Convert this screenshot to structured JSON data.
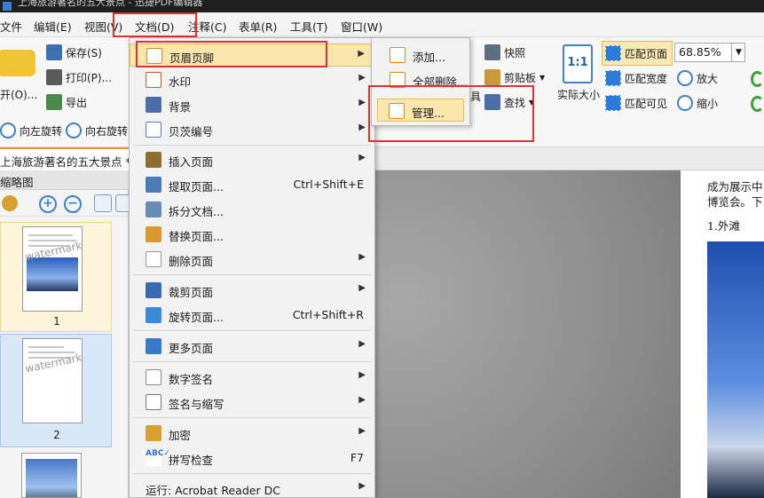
{
  "window": {
    "title": "上海旅游著名的五大景点 - 迅捷PDF编辑器"
  },
  "menubar": {
    "items": [
      {
        "label": "文件"
      },
      {
        "label": "编辑(E)"
      },
      {
        "label": "视图(V)"
      },
      {
        "label": "文档(D)"
      },
      {
        "label": "注释(C)"
      },
      {
        "label": "表单(R)"
      },
      {
        "label": "工具(T)"
      },
      {
        "label": "窗口(W)"
      }
    ]
  },
  "ribbon": {
    "open_label": "开(O)...",
    "save_label": "保存(S)",
    "print_label": "打印(P)...",
    "export_label": "导出",
    "rotate_left_label": "向左旋转",
    "rotate_right_label": "向右旋转",
    "snapshot_label": "快照",
    "clipboard_label": "剪贴板",
    "tools_partial_label": "具",
    "find_label": "查找",
    "actual_size_label": "实际大小",
    "actual_size_icon_text": "1:1",
    "fit_page_label": "匹配页面",
    "fit_width_label": "匹配宽度",
    "fit_visible_label": "匹配可见",
    "zoom_in_label": "放大",
    "zoom_out_label": "缩小",
    "zoom_value": "68.85%"
  },
  "tabs": {
    "document_tab": "上海旅游著名的五大景点 *"
  },
  "sidebar": {
    "title": "缩略图",
    "thumbnails": [
      {
        "page": "1",
        "watermark": "watermark"
      },
      {
        "page": "2",
        "watermark": "watermark"
      }
    ]
  },
  "page_content": {
    "line1": "成为展示中",
    "line2": "博览会。下",
    "heading": "1.外滩"
  },
  "document_menu": {
    "items": [
      {
        "label": "页眉页脚",
        "shortcut": "",
        "submenu": true,
        "icon": "header-footer-icon"
      },
      {
        "label": "水印",
        "shortcut": "",
        "submenu": true,
        "icon": "watermark-icon"
      },
      {
        "label": "背景",
        "shortcut": "",
        "submenu": true,
        "icon": "background-icon"
      },
      {
        "label": "贝茨编号",
        "shortcut": "",
        "submenu": true,
        "icon": "bates-number-icon"
      },
      {
        "label": "插入页面",
        "shortcut": "",
        "submenu": true,
        "icon": "insert-page-icon"
      },
      {
        "label": "提取页面...",
        "shortcut": "Ctrl+Shift+E",
        "submenu": false,
        "icon": "extract-page-icon"
      },
      {
        "label": "拆分文档...",
        "shortcut": "",
        "submenu": false,
        "icon": "split-document-icon"
      },
      {
        "label": "替换页面...",
        "shortcut": "",
        "submenu": false,
        "icon": "replace-page-icon"
      },
      {
        "label": "删除页面",
        "shortcut": "",
        "submenu": true,
        "icon": "delete-page-icon"
      },
      {
        "label": "裁剪页面",
        "shortcut": "",
        "submenu": true,
        "icon": "crop-page-icon"
      },
      {
        "label": "旋转页面...",
        "shortcut": "Ctrl+Shift+R",
        "submenu": false,
        "icon": "rotate-page-icon"
      },
      {
        "label": "更多页面",
        "shortcut": "",
        "submenu": true,
        "icon": "more-pages-icon"
      },
      {
        "label": "数字签名",
        "shortcut": "",
        "submenu": true,
        "icon": "digital-signature-icon"
      },
      {
        "label": "签名与缩写",
        "shortcut": "",
        "submenu": true,
        "icon": "sign-initials-icon"
      },
      {
        "label": "加密",
        "shortcut": "",
        "submenu": true,
        "icon": "encrypt-icon"
      },
      {
        "label": "拼写检查",
        "shortcut": "F7",
        "submenu": false,
        "icon": "spell-check-icon"
      },
      {
        "label": "运行: Acrobat Reader DC",
        "shortcut": "",
        "submenu": true,
        "icon": "acrobat-icon"
      }
    ]
  },
  "header_footer_submenu": {
    "items": [
      {
        "label": "添加..."
      },
      {
        "label": "全部删除..."
      },
      {
        "label": "管理..."
      }
    ]
  },
  "colors": {
    "highlight": "#fbe6ae",
    "annotation_red": "#e03030",
    "menu_background": "#f2f2f2"
  }
}
